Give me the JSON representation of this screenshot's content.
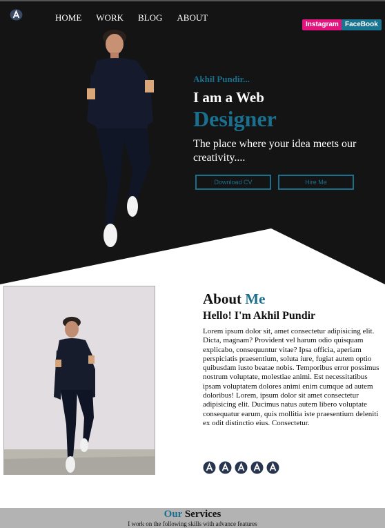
{
  "nav": {
    "items": [
      {
        "label": "HOME"
      },
      {
        "label": "WORK"
      },
      {
        "label": "BLOG"
      },
      {
        "label": "ABOUT"
      }
    ]
  },
  "social": {
    "instagram": "Instagram",
    "facebook": "FaceBook"
  },
  "hero": {
    "name": "Akhil Pundir...",
    "headline": "I am a Web",
    "role": "Designer",
    "tagline": "The place where your idea meets our creativity....",
    "download_cv": "Download CV",
    "hire_me": "Hire Me"
  },
  "about": {
    "title_main": "About",
    "title_accent": "Me",
    "subtitle": "Hello! I'm Akhil Pundir",
    "body": "Lorem ipsum dolor sit, amet consectetur adipisicing elit. Dicta, magnam? Provident vel harum odio quisquam explicabo, consequuntur vitae? Ipsa officia, aperiam perspiciatis praesentium, soluta iure, fugiat autem optio quibusdam iusto beatae nobis. Temporibus error possimus nostrum voluptate, molestiae animi. Est necessitatibus ipsam voluptatem dolores animi enim cumque ad autem doloribus! Lorem, ipsum dolor sit amet consectetur adipisicing elit. Ducimus natus autem libero voluptate consequatur earum, quis mollitia iste praesentium deleniti ex odit distinctio eius. Consectetur."
  },
  "services": {
    "title_accent": "Our",
    "title_main": "Services",
    "subtitle": "I work on the following skills with advance features"
  },
  "colors": {
    "accent": "#1a6f8e",
    "hero_bg": "#141414",
    "instagram": "#e4127d",
    "facebook": "#197692",
    "services_bg": "#b3b3b3"
  },
  "icons": {
    "logo": "logo-icon",
    "about_social": [
      "social-icon-1",
      "social-icon-2",
      "social-icon-3",
      "social-icon-4",
      "social-icon-5"
    ]
  }
}
